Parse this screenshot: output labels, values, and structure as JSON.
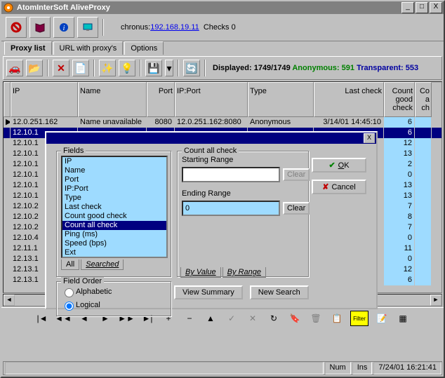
{
  "window": {
    "title": "AtomInterSoft AliveProxy"
  },
  "topbar": {
    "server_label": "chronus:",
    "server_addr": "192.168.19.11",
    "checks": "Checks 0"
  },
  "tabs": {
    "t1": "Proxy list",
    "t2": "URL with proxy's",
    "t3": "Options"
  },
  "display": {
    "label": "Displayed:",
    "value": "1749/1749",
    "anon_label": "Anonymous:",
    "anon_value": "591",
    "trans_label": "Transparent:",
    "trans_value": "553"
  },
  "columns": {
    "ip": "IP",
    "name": "Name",
    "port": "Port",
    "ipport": "IP:Port",
    "type": "Type",
    "last": "Last check",
    "good": "Count good check",
    "all": "Count all check"
  },
  "rows": [
    {
      "ip": "12.0.251.162",
      "name": "Name unavailable",
      "port": "8080",
      "ipport": "12.0.251.162:8080",
      "type": "Anonymous",
      "last": "3/14/01 14:45:10",
      "good": "6",
      "all": ""
    },
    {
      "ip": "12.10.1",
      "good": "6"
    },
    {
      "ip": "12.10.1",
      "good": "12"
    },
    {
      "ip": "12.10.1",
      "good": "13"
    },
    {
      "ip": "12.10.1",
      "good": "2"
    },
    {
      "ip": "12.10.1",
      "good": "0"
    },
    {
      "ip": "12.10.1",
      "good": "13"
    },
    {
      "ip": "12.10.1",
      "good": "13"
    },
    {
      "ip": "12.10.2",
      "good": "7"
    },
    {
      "ip": "12.10.2",
      "good": "8"
    },
    {
      "ip": "12.10.2",
      "good": "7"
    },
    {
      "ip": "12.10.4",
      "good": "0"
    },
    {
      "ip": "12.11.1",
      "good": "11"
    },
    {
      "ip": "12.13.1",
      "good": "0"
    },
    {
      "ip": "12.13.1",
      "good": "12"
    },
    {
      "ip": "12.13.1",
      "good": "6"
    }
  ],
  "dialog": {
    "fields_label": "Fields",
    "field_items": [
      "IP",
      "Name",
      "Port",
      "IP:Port",
      "Type",
      "Last check",
      "Count good check",
      "Count all check",
      "Ping (ms)",
      "Speed (bps)",
      "Ext"
    ],
    "field_selected_index": 7,
    "tab_all": "All",
    "tab_searched": "Searched",
    "count_label": "Count all check",
    "start_label": "Starting Range",
    "start_value": "",
    "end_label": "Ending Range",
    "end_value": "0",
    "clear": "Clear",
    "byvalue": "By Value",
    "byrange": "By Range",
    "ok": "OK",
    "cancel": "Cancel",
    "field_order": "Field Order",
    "alpha": "Alphabetic",
    "logical": "Logical",
    "view_summary": "View Summary",
    "new_search": "New Search"
  },
  "status": {
    "num": "Num",
    "ins": "Ins",
    "time": "7/24/01 16:21:41"
  }
}
